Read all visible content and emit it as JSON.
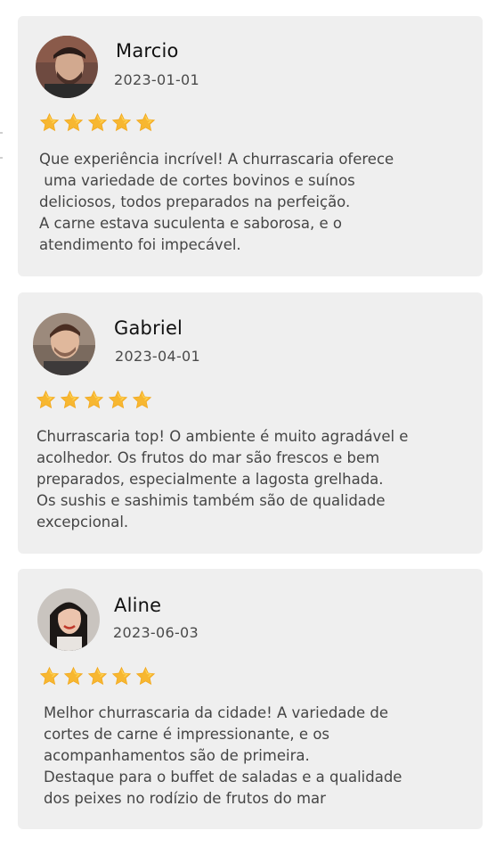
{
  "reviews": [
    {
      "name": "Marcio",
      "date": "2023-01-01",
      "rating": 5,
      "lines": [
        "Que experiência incrível! A churrascaria oferece",
        " uma variedade de cortes bovinos e suínos",
        "deliciosos, todos preparados na perfeição.",
        "A carne estava suculenta e saborosa, e o",
        "atendimento foi impecável."
      ]
    },
    {
      "name": "Gabriel",
      "date": "2023-04-01",
      "rating": 5,
      "lines": [
        "Churrascaria top! O ambiente é muito agradável e",
        "acolhedor. Os frutos do mar são frescos e bem",
        "preparados, especialmente a lagosta grelhada.",
        "Os sushis e sashimis também são de qualidade",
        "excepcional."
      ]
    },
    {
      "name": "Aline",
      "date": "2023-06-03",
      "rating": 5,
      "lines": [
        "Melhor churrascaria da cidade! A variedade de",
        "cortes de carne é impressionante, e os",
        "acompanhamentos são de primeira.",
        "Destaque para o buffet de saladas e a qualidade",
        "dos peixes no rodízio de frutos do mar"
      ]
    }
  ],
  "icons": {
    "star": "star-icon",
    "avatar": "avatar-photo"
  },
  "colors": {
    "card_background": "#efefef",
    "star_fill": "#f7b731",
    "star_highlight": "#ffd75a",
    "name_text": "#111111",
    "body_text": "#454545"
  }
}
